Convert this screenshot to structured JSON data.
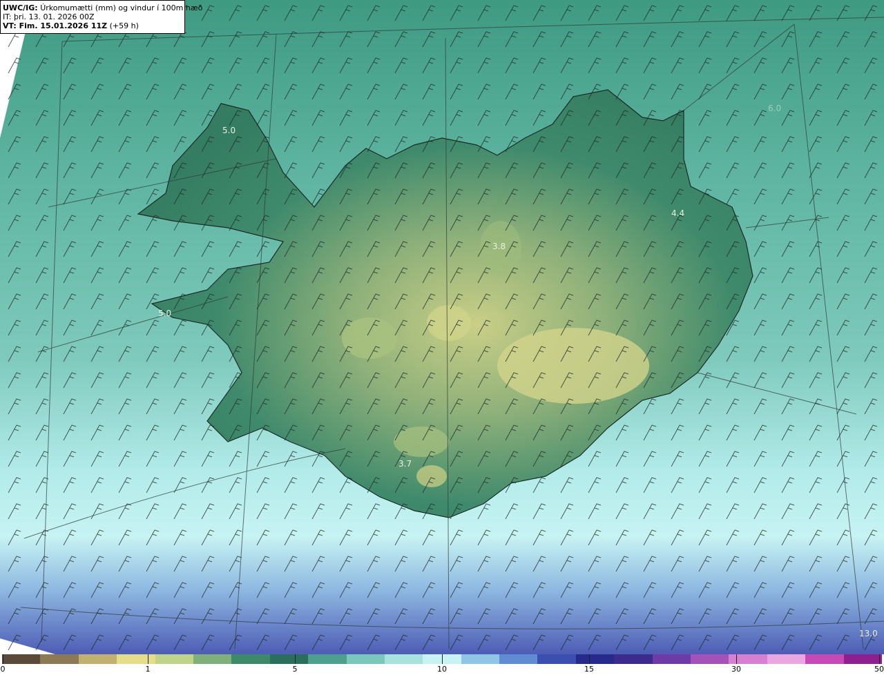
{
  "header": {
    "product_prefix": "UWC/IG:",
    "product_desc": "Úrkomumætti (mm) og vindur í 100m hæð",
    "init_time": "IT: þri. 13. 01. 2026 00Z",
    "valid_prefix": "VT: Fim. 15.01.2026 11Z",
    "valid_offset": "(+59 h)"
  },
  "map_labels": [
    {
      "text": "5.0"
    },
    {
      "text": "5.0"
    },
    {
      "text": "3.8"
    },
    {
      "text": "4.4"
    },
    {
      "text": "3.7"
    },
    {
      "text": "13.0"
    },
    {
      "text": "6.0"
    }
  ],
  "colorbar": {
    "ticks": [
      "0",
      "1",
      "5",
      "10",
      "15",
      "30",
      "50"
    ],
    "colors": [
      "#5a4a3a",
      "#8c7a55",
      "#c2b070",
      "#e6dd8a",
      "#bfd38a",
      "#7fb07a",
      "#3d8a6a",
      "#2a6f5e",
      "#4f9f8f",
      "#7ac7bb",
      "#a8e2de",
      "#c9f2f2",
      "#8fc6e6",
      "#5f8cd2",
      "#3b4fb0",
      "#262a8a",
      "#3a2b8c",
      "#6e3aa6",
      "#a552b8",
      "#d77fd0",
      "#e9a6e0",
      "#c64ab5",
      "#8e1f8f"
    ]
  },
  "legend_colors": {
    "sea": "#7ec9bc",
    "land": "#3f8a6c",
    "highland": "#bdc77f",
    "south_sea": "#b4ecee",
    "deep": "#5a6fc4"
  }
}
